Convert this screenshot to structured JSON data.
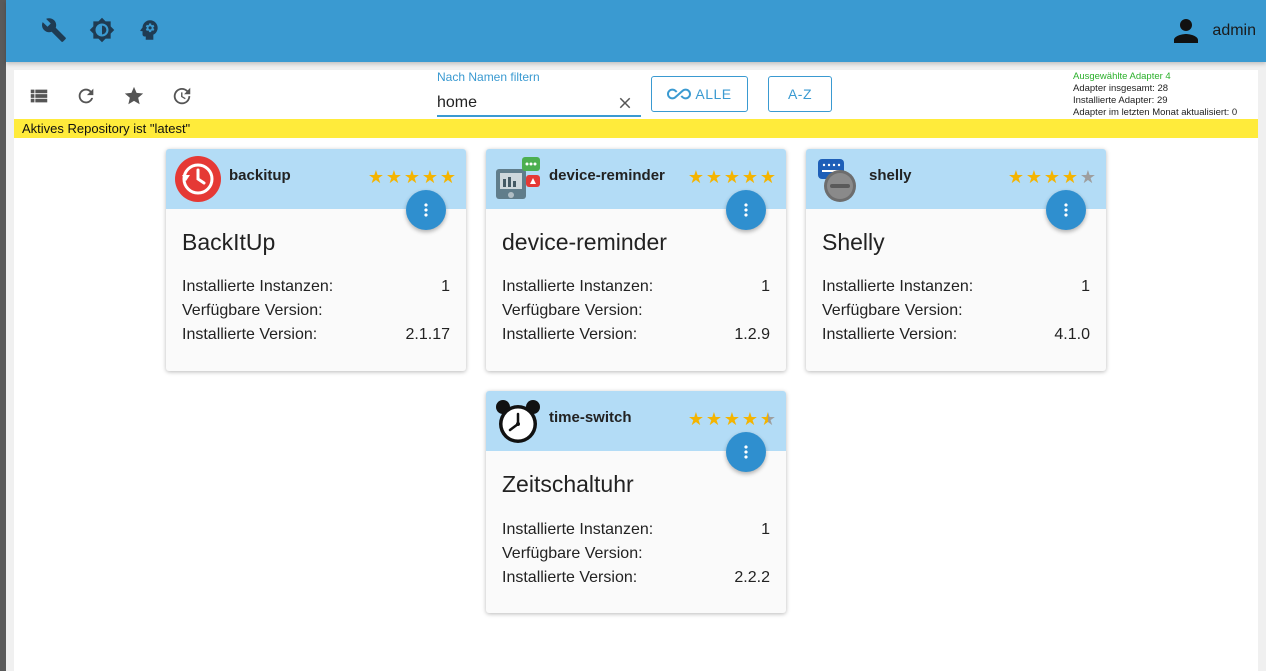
{
  "header": {
    "icons": [
      "wrench-icon",
      "theme-icon",
      "expert-mode-icon"
    ],
    "user": "admin"
  },
  "toolbar": {
    "icons": [
      "list-view-icon",
      "refresh-icon",
      "star-icon",
      "update-history-icon"
    ]
  },
  "filter": {
    "label": "Nach Namen filtern",
    "value": "home"
  },
  "buttons": {
    "all": "ALLE",
    "sort": "A-Z"
  },
  "stats": {
    "selected": "Ausgewählte Adapter 4",
    "total": "Adapter insgesamt: 28",
    "installed": "Installierte Adapter: 29",
    "updated": "Adapter im letzten Monat aktualisiert: 0"
  },
  "repo_banner": "Aktives Repository ist \"latest\"",
  "labels": {
    "instances": "Installierte Instanzen:",
    "available": "Verfügbare Version:",
    "installed_version": "Installierte Version:"
  },
  "cards": [
    {
      "name": "backitup",
      "title": "BackItUp",
      "rating": 5,
      "instances": "1",
      "available": "",
      "installed": "2.1.17",
      "logo": "backitup-logo"
    },
    {
      "name": "device-reminder",
      "title": "device-reminder",
      "rating": 5,
      "instances": "1",
      "available": "",
      "installed": "1.2.9",
      "logo": "device-reminder-logo"
    },
    {
      "name": "shelly",
      "title": "Shelly",
      "rating": 4,
      "instances": "1",
      "available": "",
      "installed": "4.1.0",
      "logo": "shelly-logo"
    },
    {
      "name": "time-switch",
      "title": "Zeitschaltuhr",
      "rating": 4.5,
      "instances": "1",
      "available": "",
      "installed": "2.2.2",
      "logo": "alarm-clock-logo"
    }
  ],
  "colors": {
    "header": "#3a9ad1",
    "card_header": "#b3dcf6",
    "banner": "#ffeb3b",
    "star": "#f4b400",
    "fab": "#2f8fcf"
  }
}
